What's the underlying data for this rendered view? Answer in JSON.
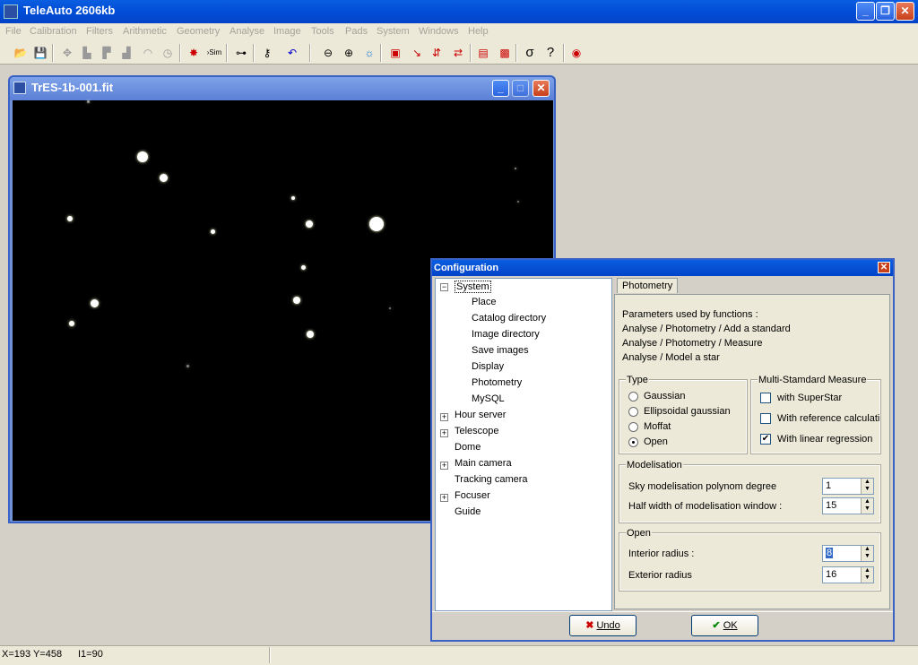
{
  "app": {
    "title": "TeleAuto 2606kb"
  },
  "menu": [
    "File",
    "Calibration",
    "Filters",
    "Arithmetic",
    "Geometry",
    "Analyse",
    "Image",
    "Tools",
    "Pads",
    "System",
    "Windows",
    "Help"
  ],
  "image_window": {
    "title": "TrES-1b-001.fit"
  },
  "dialog": {
    "title": "Configuration",
    "tree": [
      "System",
      "Place",
      "Catalog directory",
      "Image directory",
      "Save images",
      "Display",
      "Photometry",
      "MySQL",
      "Hour server",
      "Telescope",
      "Dome",
      "Main camera",
      "Tracking camera",
      "Focuser",
      "Guide"
    ],
    "tab": "Photometry",
    "description": [
      "Parameters used by functions :",
      "Analyse / Photometry / Add a standard",
      "Analyse / Photometry / Measure",
      "Analyse / Model a star"
    ],
    "type_group": {
      "label": "Type",
      "options": [
        "Gaussian",
        "Ellipsoidal gaussian",
        "Moffat",
        "Open"
      ],
      "selected": "Open"
    },
    "multi_group": {
      "label": "Multi-Stamdard Measure",
      "options": [
        "with SuperStar",
        "With reference calculatic",
        "With linear regression"
      ],
      "checked": [
        false,
        false,
        true
      ]
    },
    "model_group": {
      "label": "Modelisation",
      "sky_label": "Sky modelisation polynom degree",
      "sky_value": "1",
      "half_label": "Half width of modelisation window :",
      "half_value": "15"
    },
    "open_group": {
      "label": "Open",
      "interior_label": "Interior radius :",
      "interior_value": "8",
      "exterior_label": "Exterior radius",
      "exterior_value": "16"
    },
    "undo_label": "Undo",
    "ok_label": "OK"
  },
  "status": {
    "coords": "X=193 Y=458",
    "intensity": "I1=90"
  }
}
